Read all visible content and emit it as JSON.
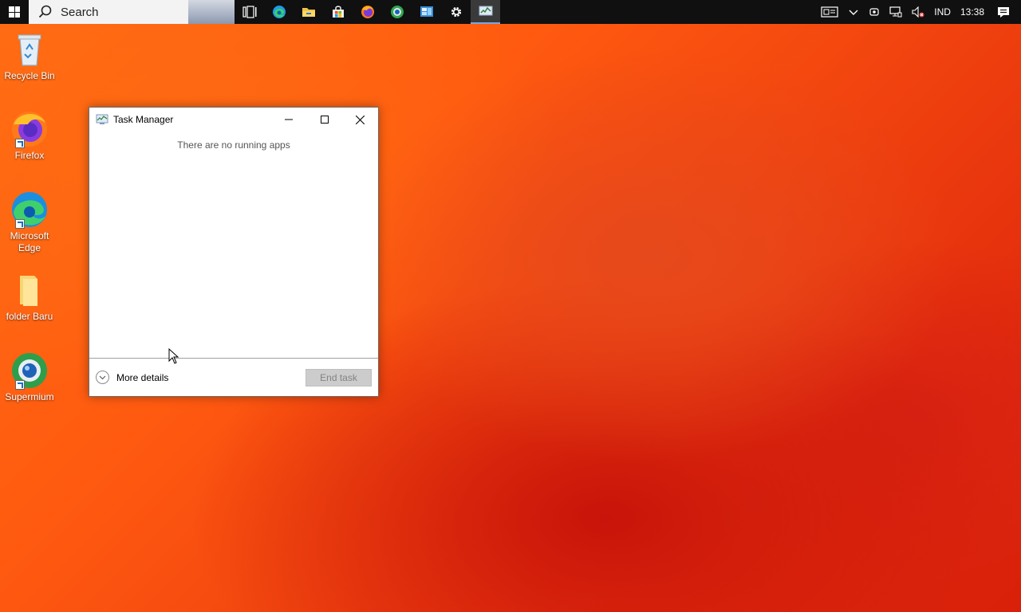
{
  "taskbar": {
    "search_placeholder": "Search",
    "pinned": [
      {
        "name": "task-view-icon"
      },
      {
        "name": "edge-icon"
      },
      {
        "name": "file-explorer-icon"
      },
      {
        "name": "store-icon"
      },
      {
        "name": "firefox-icon"
      },
      {
        "name": "supermium-icon"
      },
      {
        "name": "control-panel-icon"
      },
      {
        "name": "settings-gear-icon"
      },
      {
        "name": "task-manager-icon"
      }
    ],
    "tray": {
      "language": "IND",
      "time": "13:38"
    }
  },
  "desktop": {
    "icons": [
      {
        "label": "Recycle Bin"
      },
      {
        "label": "Firefox"
      },
      {
        "label": "Microsoft Edge"
      },
      {
        "label": "folder Baru"
      },
      {
        "label": "Supermium"
      }
    ]
  },
  "task_manager": {
    "title": "Task Manager",
    "empty_message": "There are no running apps",
    "more_details_label": "More details",
    "end_task_label": "End task"
  }
}
